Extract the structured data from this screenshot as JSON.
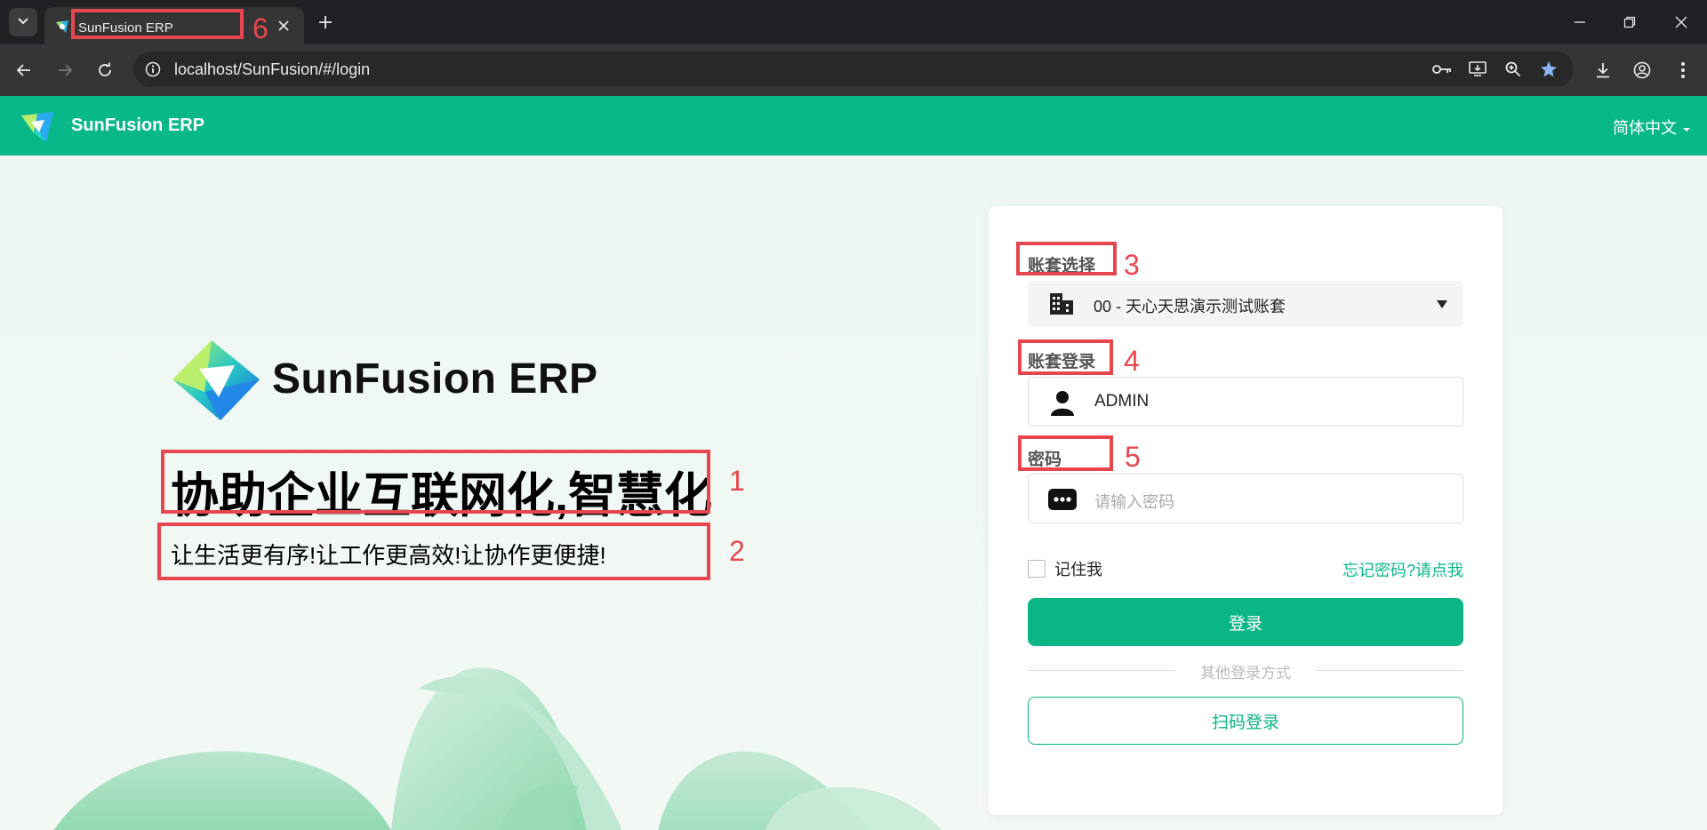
{
  "browser": {
    "tab_title": "SunFusion ERP",
    "url": "localhost/SunFusion/#/login"
  },
  "header": {
    "app_title": "SunFusion ERP",
    "language": "简体中文"
  },
  "hero": {
    "brand_name": "SunFusion ERP",
    "slogan": "协助企业互联网化,智慧化",
    "sub_slogan": "让生活更有序!让工作更高效!让协作更便捷!"
  },
  "login": {
    "account_set_label": "账套选择",
    "account_set_value": "00 - 天心天思演示测试账套",
    "username_label": "账套登录",
    "username_value": "ADMIN",
    "password_label": "密码",
    "password_placeholder": "请输入密码",
    "remember_label": "记住我",
    "forgot_label": "忘记密码?请点我",
    "login_button": "登录",
    "other_methods": "其他登录方式",
    "qr_button": "扫码登录"
  },
  "annotations": [
    "1",
    "2",
    "3",
    "4",
    "5",
    "6"
  ],
  "colors": {
    "brand_green": "#08b889",
    "annotation_red": "#e8464f"
  },
  "icons": [
    "tab-list-icon",
    "app-favicon-icon",
    "close-icon",
    "plus-icon",
    "minimize-icon",
    "restore-icon",
    "window-close-icon",
    "back-icon",
    "forward-icon",
    "reload-icon",
    "site-info-icon",
    "password-key-icon",
    "install-app-icon",
    "zoom-icon",
    "bookmark-star-icon",
    "download-icon",
    "profile-icon",
    "menu-dots-icon",
    "building-icon",
    "user-icon",
    "password-dots-icon",
    "chevron-down-icon"
  ]
}
